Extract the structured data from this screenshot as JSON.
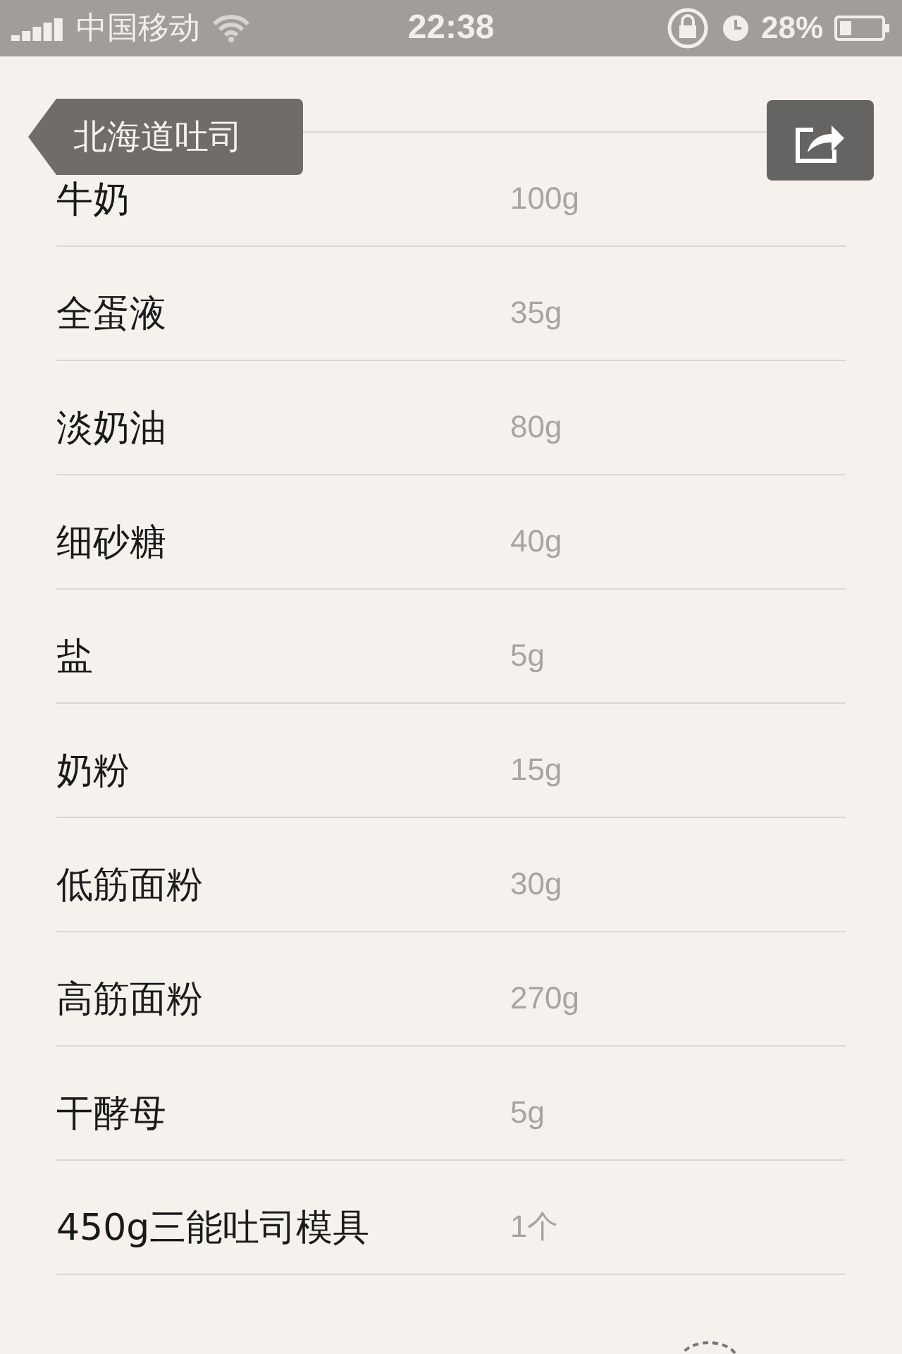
{
  "status_bar": {
    "carrier": "中国移动",
    "time": "22:38",
    "battery": "28%"
  },
  "nav": {
    "back": "北海道吐司"
  },
  "ingredients": [
    {
      "name": "牛奶",
      "amount": "100g"
    },
    {
      "name": "全蛋液",
      "amount": "35g"
    },
    {
      "name": "淡奶油",
      "amount": "80g"
    },
    {
      "name": "细砂糖",
      "amount": "40g"
    },
    {
      "name": "盐",
      "amount": "5g"
    },
    {
      "name": "奶粉",
      "amount": "15g"
    },
    {
      "name": "低筋面粉",
      "amount": "30g"
    },
    {
      "name": "高筋面粉",
      "amount": "270g"
    },
    {
      "name": "干酵母",
      "amount": "5g"
    },
    {
      "name": "450g三能吐司模具",
      "amount": "1个"
    }
  ]
}
